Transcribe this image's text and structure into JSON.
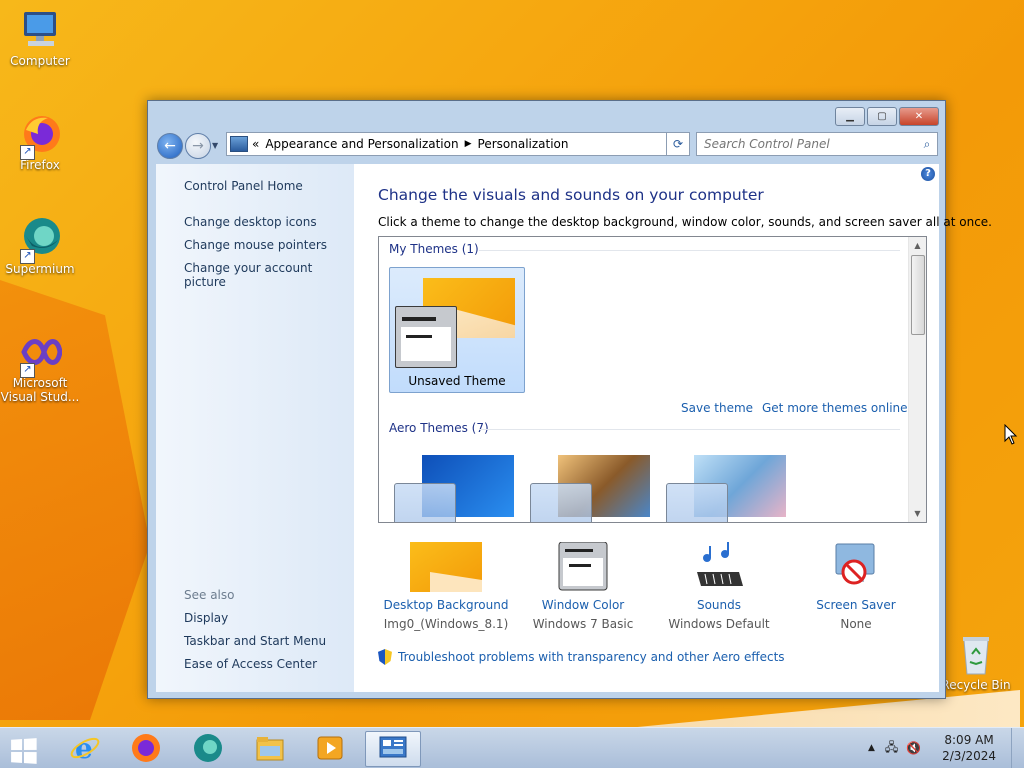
{
  "desktop": {
    "icons": [
      {
        "label": "Computer"
      },
      {
        "label": "Firefox"
      },
      {
        "label": "Supermium"
      },
      {
        "label_line1": "Microsoft",
        "label_line2": "Visual Stud..."
      },
      {
        "label": "Recycle Bin"
      }
    ]
  },
  "window": {
    "address": {
      "prefix": "«",
      "crumbs": [
        "Appearance and Personalization",
        "Personalization"
      ]
    },
    "search_placeholder": "Search Control Panel",
    "left_pane": {
      "home": "Control Panel Home",
      "links": [
        "Change desktop icons",
        "Change mouse pointers",
        "Change your account picture"
      ],
      "see_also": "See also",
      "see_also_links": [
        "Display",
        "Taskbar and Start Menu",
        "Ease of Access Center"
      ]
    },
    "main": {
      "title": "Change the visuals and sounds on your computer",
      "subtitle": "Click a theme to change the desktop background, window color, sounds, and screen saver all at once.",
      "my_themes_header": "My Themes (1)",
      "unsaved_theme": "Unsaved Theme",
      "save_theme": "Save theme",
      "get_more": "Get more themes online",
      "aero_header": "Aero Themes (7)",
      "bottom": [
        {
          "label": "Desktop Background",
          "value": "Img0_(Windows_8.1)"
        },
        {
          "label": "Window Color",
          "value": "Windows 7 Basic"
        },
        {
          "label": "Sounds",
          "value": "Windows Default"
        },
        {
          "label": "Screen Saver",
          "value": "None"
        }
      ],
      "troubleshoot": "Troubleshoot problems with transparency and other Aero effects"
    }
  },
  "taskbar": {
    "time": "8:09 AM",
    "date": "2/3/2024",
    "apps": [
      "internet-explorer",
      "firefox",
      "supermium",
      "file-explorer",
      "media-player",
      "control-panel"
    ]
  }
}
